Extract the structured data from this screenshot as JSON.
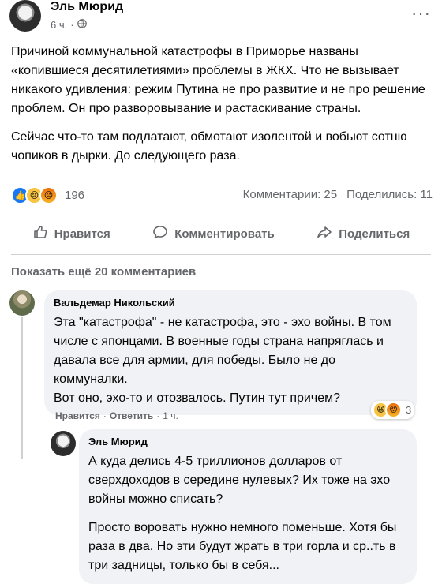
{
  "post": {
    "author": "Эль Мюрид",
    "time": "6 ч.",
    "privacy_icon": "globe-icon",
    "paragraphs": [
      "Причиной коммунальной катастрофы в Приморье названы «копившиеся десятилетиями» проблемы в ЖКХ. Что не вызывает никакого удивления: режим Путина не про развитие и не про решение проблем. Он про разворовывание и растаскивание страны.",
      "Сейчас что-то там подлатают, обмотают изолентой и вобьют сотню чопиков в дырки. До следующего раза."
    ],
    "reactions_count": "196",
    "comments_stat": "Комментарии: 25",
    "shares_stat": "Поделились: 11"
  },
  "actions": {
    "like": "Нравится",
    "comment": "Комментировать",
    "share": "Поделиться"
  },
  "show_more_comments": "Показать ещё 20 комментариев",
  "comments": [
    {
      "author": "Вальдемар Никольский",
      "text": "Эта \"катастрофа\" - не катастрофа, это - эхо войны. В том числе с японцами. В военные годы страна напряглась и давала все для армии, для победы. Было не до коммуналки.\nВот оно, эхо-то и отозвалось. Путин тут причем?",
      "like_label": "Нравится",
      "reply_label": "Ответить",
      "time": "1 ч.",
      "reactions_count": "3"
    },
    {
      "author": "Эль Мюрид",
      "paragraphs": [
        "А куда делись 4-5 триллионов долларов от сверхдоходов в середине нулевых? Их тоже на эхо войны можно списать?",
        "Просто воровать нужно немного поменьше. Хотя бы раза в два. Но эти будут жрать в три горла и ср..ть в три задницы, только бы в себя..."
      ]
    }
  ]
}
